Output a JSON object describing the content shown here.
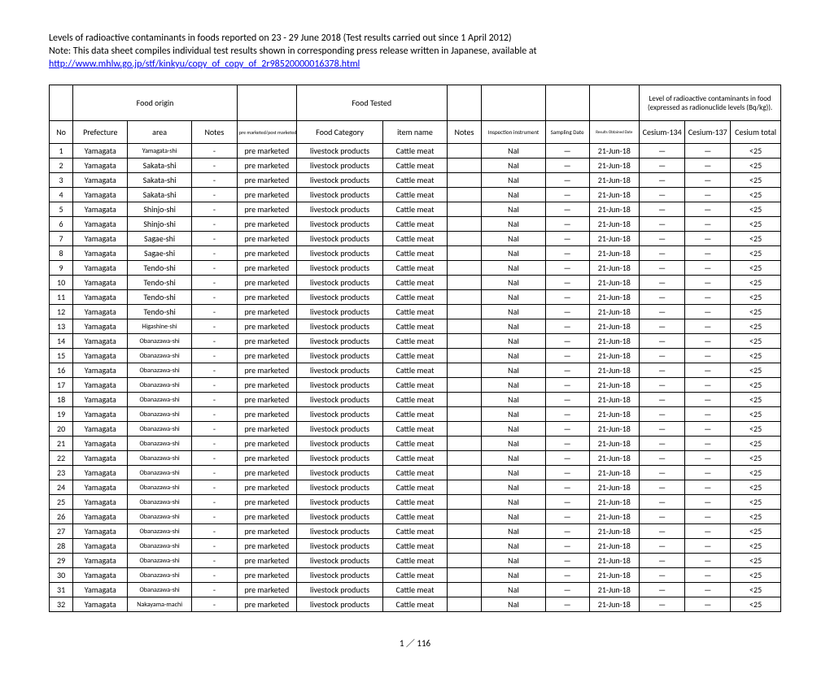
{
  "header": {
    "title": "Levels of radioactive contaminants in foods reported on 23 - 29 June 2018 (Test results carried out since 1 April 2012)",
    "note": "Note: This data sheet compiles individual test results shown in corresponding press release written in Japanese, available at",
    "link": "http://www.mhlw.go.jp/stf/kinkyu/copy_of_copy_of_2r98520000016378.html"
  },
  "table": {
    "header_group": {
      "food_origin": "Food origin",
      "food_tested": "Food Tested",
      "contaminants": "Level of radioactive contaminants in food (expressed as radionuclide levels (Bq/kg))."
    },
    "headers": {
      "no": "No",
      "prefecture": "Prefecture",
      "area": "area",
      "notes1": "Notes",
      "prepost": "pre marketed/post marketed",
      "category": "Food Category",
      "item": "item name",
      "notes2": "Notes",
      "instrument": "Inspection instrument",
      "sampling": "Sampling Date",
      "results": "Results Obtained Date",
      "cs134": "Cesium-134",
      "cs137": "Cesium-137",
      "cstotal": "Cesium total"
    },
    "rows": [
      {
        "no": "1",
        "pref": "Yamagata",
        "area": "Yamagata-shi",
        "n1": "-",
        "pp": "pre marketed",
        "cat": "livestock products",
        "item": "Cattle meat",
        "n2": "",
        "inst": "NaI",
        "sd": "－",
        "rd": "21-Jun-18",
        "c1": "－",
        "c2": "－",
        "ct": "<25"
      },
      {
        "no": "2",
        "pref": "Yamagata",
        "area": "Sakata-shi",
        "n1": "-",
        "pp": "pre marketed",
        "cat": "livestock products",
        "item": "Cattle meat",
        "n2": "",
        "inst": "NaI",
        "sd": "－",
        "rd": "21-Jun-18",
        "c1": "－",
        "c2": "－",
        "ct": "<25"
      },
      {
        "no": "3",
        "pref": "Yamagata",
        "area": "Sakata-shi",
        "n1": "-",
        "pp": "pre marketed",
        "cat": "livestock products",
        "item": "Cattle meat",
        "n2": "",
        "inst": "NaI",
        "sd": "－",
        "rd": "21-Jun-18",
        "c1": "－",
        "c2": "－",
        "ct": "<25"
      },
      {
        "no": "4",
        "pref": "Yamagata",
        "area": "Sakata-shi",
        "n1": "-",
        "pp": "pre marketed",
        "cat": "livestock products",
        "item": "Cattle meat",
        "n2": "",
        "inst": "NaI",
        "sd": "－",
        "rd": "21-Jun-18",
        "c1": "－",
        "c2": "－",
        "ct": "<25"
      },
      {
        "no": "5",
        "pref": "Yamagata",
        "area": "Shinjo-shi",
        "n1": "-",
        "pp": "pre marketed",
        "cat": "livestock products",
        "item": "Cattle meat",
        "n2": "",
        "inst": "NaI",
        "sd": "－",
        "rd": "21-Jun-18",
        "c1": "－",
        "c2": "－",
        "ct": "<25"
      },
      {
        "no": "6",
        "pref": "Yamagata",
        "area": "Shinjo-shi",
        "n1": "-",
        "pp": "pre marketed",
        "cat": "livestock products",
        "item": "Cattle meat",
        "n2": "",
        "inst": "NaI",
        "sd": "－",
        "rd": "21-Jun-18",
        "c1": "－",
        "c2": "－",
        "ct": "<25"
      },
      {
        "no": "7",
        "pref": "Yamagata",
        "area": "Sagae-shi",
        "n1": "-",
        "pp": "pre marketed",
        "cat": "livestock products",
        "item": "Cattle meat",
        "n2": "",
        "inst": "NaI",
        "sd": "－",
        "rd": "21-Jun-18",
        "c1": "－",
        "c2": "－",
        "ct": "<25"
      },
      {
        "no": "8",
        "pref": "Yamagata",
        "area": "Sagae-shi",
        "n1": "-",
        "pp": "pre marketed",
        "cat": "livestock products",
        "item": "Cattle meat",
        "n2": "",
        "inst": "NaI",
        "sd": "－",
        "rd": "21-Jun-18",
        "c1": "－",
        "c2": "－",
        "ct": "<25"
      },
      {
        "no": "9",
        "pref": "Yamagata",
        "area": "Tendo-shi",
        "n1": "-",
        "pp": "pre marketed",
        "cat": "livestock products",
        "item": "Cattle meat",
        "n2": "",
        "inst": "NaI",
        "sd": "－",
        "rd": "21-Jun-18",
        "c1": "－",
        "c2": "－",
        "ct": "<25"
      },
      {
        "no": "10",
        "pref": "Yamagata",
        "area": "Tendo-shi",
        "n1": "-",
        "pp": "pre marketed",
        "cat": "livestock products",
        "item": "Cattle meat",
        "n2": "",
        "inst": "NaI",
        "sd": "－",
        "rd": "21-Jun-18",
        "c1": "－",
        "c2": "－",
        "ct": "<25"
      },
      {
        "no": "11",
        "pref": "Yamagata",
        "area": "Tendo-shi",
        "n1": "-",
        "pp": "pre marketed",
        "cat": "livestock products",
        "item": "Cattle meat",
        "n2": "",
        "inst": "NaI",
        "sd": "－",
        "rd": "21-Jun-18",
        "c1": "－",
        "c2": "－",
        "ct": "<25"
      },
      {
        "no": "12",
        "pref": "Yamagata",
        "area": "Tendo-shi",
        "n1": "-",
        "pp": "pre marketed",
        "cat": "livestock products",
        "item": "Cattle meat",
        "n2": "",
        "inst": "NaI",
        "sd": "－",
        "rd": "21-Jun-18",
        "c1": "－",
        "c2": "－",
        "ct": "<25"
      },
      {
        "no": "13",
        "pref": "Yamagata",
        "area": "Higashine-shi",
        "n1": "-",
        "pp": "pre marketed",
        "cat": "livestock products",
        "item": "Cattle meat",
        "n2": "",
        "inst": "NaI",
        "sd": "－",
        "rd": "21-Jun-18",
        "c1": "－",
        "c2": "－",
        "ct": "<25"
      },
      {
        "no": "14",
        "pref": "Yamagata",
        "area": "Obanazawa-shi",
        "n1": "-",
        "pp": "pre marketed",
        "cat": "livestock products",
        "item": "Cattle meat",
        "n2": "",
        "inst": "NaI",
        "sd": "－",
        "rd": "21-Jun-18",
        "c1": "－",
        "c2": "－",
        "ct": "<25"
      },
      {
        "no": "15",
        "pref": "Yamagata",
        "area": "Obanazawa-shi",
        "n1": "-",
        "pp": "pre marketed",
        "cat": "livestock products",
        "item": "Cattle meat",
        "n2": "",
        "inst": "NaI",
        "sd": "－",
        "rd": "21-Jun-18",
        "c1": "－",
        "c2": "－",
        "ct": "<25"
      },
      {
        "no": "16",
        "pref": "Yamagata",
        "area": "Obanazawa-shi",
        "n1": "-",
        "pp": "pre marketed",
        "cat": "livestock products",
        "item": "Cattle meat",
        "n2": "",
        "inst": "NaI",
        "sd": "－",
        "rd": "21-Jun-18",
        "c1": "－",
        "c2": "－",
        "ct": "<25"
      },
      {
        "no": "17",
        "pref": "Yamagata",
        "area": "Obanazawa-shi",
        "n1": "-",
        "pp": "pre marketed",
        "cat": "livestock products",
        "item": "Cattle meat",
        "n2": "",
        "inst": "NaI",
        "sd": "－",
        "rd": "21-Jun-18",
        "c1": "－",
        "c2": "－",
        "ct": "<25"
      },
      {
        "no": "18",
        "pref": "Yamagata",
        "area": "Obanazawa-shi",
        "n1": "-",
        "pp": "pre marketed",
        "cat": "livestock products",
        "item": "Cattle meat",
        "n2": "",
        "inst": "NaI",
        "sd": "－",
        "rd": "21-Jun-18",
        "c1": "－",
        "c2": "－",
        "ct": "<25"
      },
      {
        "no": "19",
        "pref": "Yamagata",
        "area": "Obanazawa-shi",
        "n1": "-",
        "pp": "pre marketed",
        "cat": "livestock products",
        "item": "Cattle meat",
        "n2": "",
        "inst": "NaI",
        "sd": "－",
        "rd": "21-Jun-18",
        "c1": "－",
        "c2": "－",
        "ct": "<25"
      },
      {
        "no": "20",
        "pref": "Yamagata",
        "area": "Obanazawa-shi",
        "n1": "-",
        "pp": "pre marketed",
        "cat": "livestock products",
        "item": "Cattle meat",
        "n2": "",
        "inst": "NaI",
        "sd": "－",
        "rd": "21-Jun-18",
        "c1": "－",
        "c2": "－",
        "ct": "<25"
      },
      {
        "no": "21",
        "pref": "Yamagata",
        "area": "Obanazawa-shi",
        "n1": "-",
        "pp": "pre marketed",
        "cat": "livestock products",
        "item": "Cattle meat",
        "n2": "",
        "inst": "NaI",
        "sd": "－",
        "rd": "21-Jun-18",
        "c1": "－",
        "c2": "－",
        "ct": "<25"
      },
      {
        "no": "22",
        "pref": "Yamagata",
        "area": "Obanazawa-shi",
        "n1": "-",
        "pp": "pre marketed",
        "cat": "livestock products",
        "item": "Cattle meat",
        "n2": "",
        "inst": "NaI",
        "sd": "－",
        "rd": "21-Jun-18",
        "c1": "－",
        "c2": "－",
        "ct": "<25"
      },
      {
        "no": "23",
        "pref": "Yamagata",
        "area": "Obanazawa-shi",
        "n1": "-",
        "pp": "pre marketed",
        "cat": "livestock products",
        "item": "Cattle meat",
        "n2": "",
        "inst": "NaI",
        "sd": "－",
        "rd": "21-Jun-18",
        "c1": "－",
        "c2": "－",
        "ct": "<25"
      },
      {
        "no": "24",
        "pref": "Yamagata",
        "area": "Obanazawa-shi",
        "n1": "-",
        "pp": "pre marketed",
        "cat": "livestock products",
        "item": "Cattle meat",
        "n2": "",
        "inst": "NaI",
        "sd": "－",
        "rd": "21-Jun-18",
        "c1": "－",
        "c2": "－",
        "ct": "<25"
      },
      {
        "no": "25",
        "pref": "Yamagata",
        "area": "Obanazawa-shi",
        "n1": "-",
        "pp": "pre marketed",
        "cat": "livestock products",
        "item": "Cattle meat",
        "n2": "",
        "inst": "NaI",
        "sd": "－",
        "rd": "21-Jun-18",
        "c1": "－",
        "c2": "－",
        "ct": "<25"
      },
      {
        "no": "26",
        "pref": "Yamagata",
        "area": "Obanazawa-shi",
        "n1": "-",
        "pp": "pre marketed",
        "cat": "livestock products",
        "item": "Cattle meat",
        "n2": "",
        "inst": "NaI",
        "sd": "－",
        "rd": "21-Jun-18",
        "c1": "－",
        "c2": "－",
        "ct": "<25"
      },
      {
        "no": "27",
        "pref": "Yamagata",
        "area": "Obanazawa-shi",
        "n1": "-",
        "pp": "pre marketed",
        "cat": "livestock products",
        "item": "Cattle meat",
        "n2": "",
        "inst": "NaI",
        "sd": "－",
        "rd": "21-Jun-18",
        "c1": "－",
        "c2": "－",
        "ct": "<25"
      },
      {
        "no": "28",
        "pref": "Yamagata",
        "area": "Obanazawa-shi",
        "n1": "-",
        "pp": "pre marketed",
        "cat": "livestock products",
        "item": "Cattle meat",
        "n2": "",
        "inst": "NaI",
        "sd": "－",
        "rd": "21-Jun-18",
        "c1": "－",
        "c2": "－",
        "ct": "<25"
      },
      {
        "no": "29",
        "pref": "Yamagata",
        "area": "Obanazawa-shi",
        "n1": "-",
        "pp": "pre marketed",
        "cat": "livestock products",
        "item": "Cattle meat",
        "n2": "",
        "inst": "NaI",
        "sd": "－",
        "rd": "21-Jun-18",
        "c1": "－",
        "c2": "－",
        "ct": "<25"
      },
      {
        "no": "30",
        "pref": "Yamagata",
        "area": "Obanazawa-shi",
        "n1": "-",
        "pp": "pre marketed",
        "cat": "livestock products",
        "item": "Cattle meat",
        "n2": "",
        "inst": "NaI",
        "sd": "－",
        "rd": "21-Jun-18",
        "c1": "－",
        "c2": "－",
        "ct": "<25"
      },
      {
        "no": "31",
        "pref": "Yamagata",
        "area": "Obanazawa-shi",
        "n1": "-",
        "pp": "pre marketed",
        "cat": "livestock products",
        "item": "Cattle meat",
        "n2": "",
        "inst": "NaI",
        "sd": "－",
        "rd": "21-Jun-18",
        "c1": "－",
        "c2": "－",
        "ct": "<25"
      },
      {
        "no": "32",
        "pref": "Yamagata",
        "area": "Nakayama-machi",
        "n1": "-",
        "pp": "pre marketed",
        "cat": "livestock products",
        "item": "Cattle meat",
        "n2": "",
        "inst": "NaI",
        "sd": "－",
        "rd": "21-Jun-18",
        "c1": "－",
        "c2": "－",
        "ct": "<25"
      }
    ]
  },
  "footer": {
    "page": "1 ／ 116"
  }
}
